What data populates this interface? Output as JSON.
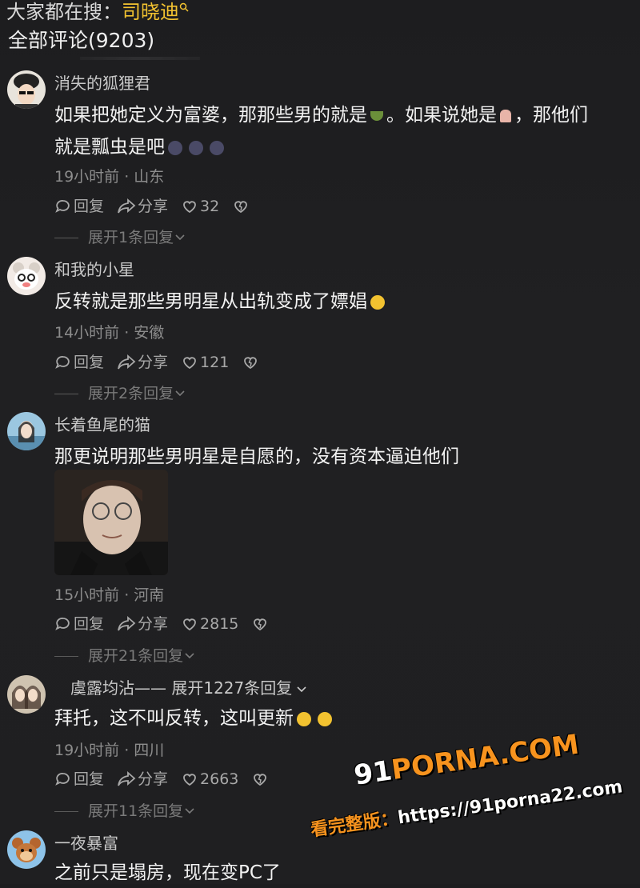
{
  "header": {
    "search_prefix": "大家都在搜：",
    "search_keyword": "司晓迪",
    "comments_title": "全部评论(9203)"
  },
  "comments": [
    {
      "username": "消失的狐狸君",
      "text_line1": "如果把她定义为富婆，那那些男的就是",
      "text_mid1": "。如果说她是",
      "text_mid2": "，那他们",
      "text_line2": "就是瓢虫是吧",
      "meta": "19小时前 · 山东",
      "reply": "回复",
      "share": "分享",
      "likes": "32",
      "expand": "展开1条回复"
    },
    {
      "username": "和我的小星",
      "text_line1": "反转就是那些男明星从出轨变成了嫖娼",
      "meta": "14小时前 · 安徽",
      "reply": "回复",
      "share": "分享",
      "likes": "121",
      "expand": "展开2条回复"
    },
    {
      "username": "长着鱼尾的猫",
      "text_line1": "那更说明那些男明星是自愿的，没有资本逼迫他们",
      "meta": "15小时前 · 河南",
      "reply": "回复",
      "share": "分享",
      "likes": "2815",
      "expand": "展开21条回复"
    },
    {
      "username": "虞露均沾",
      "username_suffix": "—— 展开1227条回复",
      "text_line1": "拜托，这不叫反转，这叫更新",
      "meta": "19小时前 · 四川",
      "reply": "回复",
      "share": "分享",
      "likes": "2663",
      "expand": "展开11条回复"
    },
    {
      "username": "一夜暴富",
      "text_line1": "之前只是塌房，现在变PC了"
    }
  ],
  "watermark": {
    "brand_prefix": "91",
    "brand_rest": "PORNA.COM",
    "label": "看完整版：",
    "url": "https://91porna22.com"
  },
  "colors": {
    "background": "#1f1f21",
    "keyword": "#f2c230",
    "watermark_orange": "#f7931e"
  }
}
